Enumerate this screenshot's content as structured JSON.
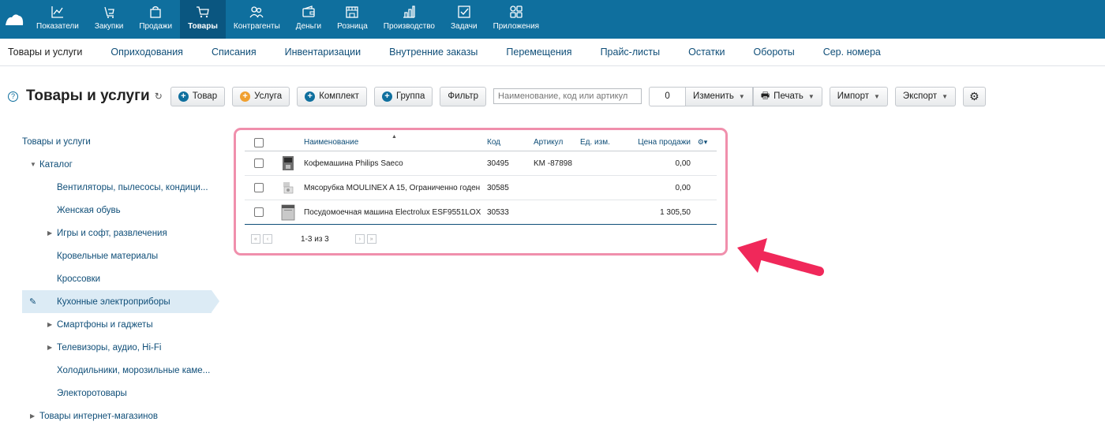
{
  "nav": {
    "items": [
      {
        "label": "Показатели",
        "icon": "chart-icon"
      },
      {
        "label": "Закупки",
        "icon": "purchases-icon"
      },
      {
        "label": "Продажи",
        "icon": "bag-icon"
      },
      {
        "label": "Товары",
        "icon": "cart-icon",
        "active": true
      },
      {
        "label": "Контрагенты",
        "icon": "people-icon"
      },
      {
        "label": "Деньги",
        "icon": "wallet-icon"
      },
      {
        "label": "Розница",
        "icon": "store-icon"
      },
      {
        "label": "Производство",
        "icon": "production-icon"
      },
      {
        "label": "Задачи",
        "icon": "tasks-icon"
      },
      {
        "label": "Приложения",
        "icon": "apps-icon"
      }
    ]
  },
  "subnav": {
    "items": [
      "Товары и услуги",
      "Оприходования",
      "Списания",
      "Инвентаризации",
      "Внутренние заказы",
      "Перемещения",
      "Прайс-листы",
      "Остатки",
      "Обороты",
      "Сер. номера"
    ]
  },
  "toolbar": {
    "title": "Товары и услуги",
    "btn_product": "Товар",
    "btn_service": "Услуга",
    "btn_kit": "Комплект",
    "btn_group": "Группа",
    "btn_filter": "Фильтр",
    "search_placeholder": "Наименование, код или артикул",
    "counter": "0",
    "btn_change": "Изменить",
    "btn_print": "Печать",
    "btn_import": "Импорт",
    "btn_export": "Экспорт"
  },
  "tree": {
    "root": "Товары и услуги",
    "catalog": "Каталог",
    "items": [
      "Вентиляторы, пылесосы, кондици...",
      "Женская обувь",
      "Игры и софт, развлечения",
      "Кровельные материалы",
      "Кроссовки",
      "Кухонные электроприборы",
      "Смартфоны и гаджеты",
      "Телевизоры, аудио, Hi-Fi",
      "Холодильники, морозильные каме...",
      "Электоротовары"
    ],
    "bottom": "Товары интернет-магазинов"
  },
  "table": {
    "columns": {
      "name": "Наименование",
      "code": "Код",
      "article": "Артикул",
      "unit": "Ед. изм.",
      "price": "Цена продажи"
    },
    "rows": [
      {
        "name": "Кофемашина Philips Saeco",
        "code": "30495",
        "article": "KM -87898",
        "unit": "",
        "price": "0,00"
      },
      {
        "name": "Мясорубка MOULINEX A 15, Ограниченно годен",
        "code": "30585",
        "article": "",
        "unit": "",
        "price": "0,00"
      },
      {
        "name": "Посудомоечная машина Electrolux ESF9551LOX",
        "code": "30533",
        "article": "",
        "unit": "",
        "price": "1 305,50"
      }
    ],
    "pager": "1-3 из 3"
  },
  "colors": {
    "topbar": "#0f6f9e",
    "highlight_frame": "#f08fac",
    "arrow": "#f0285a"
  }
}
